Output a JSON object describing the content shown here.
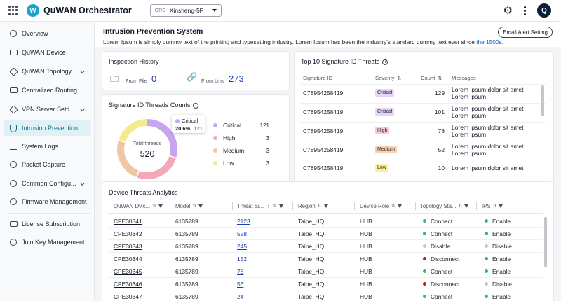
{
  "app": {
    "title": "QuWAN Orchestrator",
    "logo_letter": "W",
    "avatar_letter": "Q"
  },
  "org": {
    "label": "ORG",
    "value": "Xinsheng-5F"
  },
  "sidebar": {
    "items": [
      {
        "label": "Overview",
        "icon": "overview-icon"
      },
      {
        "label": "QuWAN Device",
        "icon": "device-icon"
      },
      {
        "label": "QuWAN Topology",
        "icon": "topology-icon"
      },
      {
        "label": "Centralized Routing",
        "icon": "routing-icon"
      },
      {
        "label": "VPN Server Setti...",
        "icon": "vpn-icon"
      },
      {
        "label": "Intrusion Prevention...",
        "icon": "shield-icon"
      },
      {
        "label": "System Logs",
        "icon": "logs-icon"
      },
      {
        "label": "Packet Capture",
        "icon": "capture-icon"
      },
      {
        "label": "Common Configu...",
        "icon": "config-icon"
      },
      {
        "label": "Firmware Management",
        "icon": "firmware-icon"
      },
      {
        "label": "License Subscription",
        "icon": "license-icon"
      },
      {
        "label": "Join Key Management",
        "icon": "key-icon"
      }
    ]
  },
  "page": {
    "title": "Intrusion Prevention System",
    "subtitle": "Lorem Ipsum is simply dummy text of the printing and typesetting industry. Lorem Ipsum has been the industry's standard dummy text ever since",
    "subtitle_link": "the 1500s.",
    "email_button": "Email Alert Setting"
  },
  "inspection": {
    "title": "Inspection History",
    "from_file_label": "From File",
    "from_file_value": "0",
    "from_link_label": "From Link",
    "from_link_value": "273"
  },
  "signature_counts": {
    "title": "Signature ID Threads Counts",
    "center_label": "Total threads",
    "total": "520",
    "tooltip": {
      "name": "Critical",
      "percent": "20.6%",
      "value": "121"
    },
    "legend": [
      {
        "name": "Critical",
        "value": "121",
        "color": "#c7a6f0"
      },
      {
        "name": "High",
        "value": "3",
        "color": "#f3a8b8"
      },
      {
        "name": "Medium",
        "value": "3",
        "color": "#f2c6a4"
      },
      {
        "name": "Low",
        "value": "3",
        "color": "#f7ea8e"
      }
    ]
  },
  "chart_data": {
    "type": "pie",
    "title": "Signature ID Threads Counts",
    "categories": [
      "Critical",
      "High",
      "Medium",
      "Low"
    ],
    "values": [
      121,
      3,
      3,
      3
    ],
    "display_fractions": [
      0.3,
      0.26,
      0.24,
      0.2
    ],
    "colors": [
      "#c7a6f0",
      "#f3a8b8",
      "#f2c6a4",
      "#f7ea8e"
    ]
  },
  "top10": {
    "title": "Top 10 Signature ID Threats",
    "headers": [
      "Signature ID",
      "Severity",
      "Count",
      "Messages"
    ],
    "rows": [
      {
        "id": "C78954258419",
        "severity": "Critical",
        "count": "129",
        "msg1": "Lorem ipsum dolor sit amet",
        "msg2": "Lorem ipsum"
      },
      {
        "id": "C78954258419",
        "severity": "Critical",
        "count": "101",
        "msg1": "Lorem ipsum dolor sit amet",
        "msg2": "Lorem ipsum"
      },
      {
        "id": "C78954258419",
        "severity": "High",
        "count": "78",
        "msg1": "Lorem ipsum dolor sit amet",
        "msg2": "Lorem ipsum"
      },
      {
        "id": "C78954258419",
        "severity": "Medium",
        "count": "52",
        "msg1": "Lorem ipsum dolor sit amet",
        "msg2": "Lorem ipsum"
      },
      {
        "id": "C78954258419",
        "severity": "Low",
        "count": "10",
        "msg1": "Lorem ipsum dolor sit amet",
        "msg2": ""
      }
    ],
    "severity_colors": {
      "Critical": "#e6d3f7",
      "High": "#f9c9d3",
      "Medium": "#f7d3b5",
      "Low": "#f7ef9a"
    }
  },
  "analytics": {
    "title": "Device Threats Analytics",
    "headers": [
      "QuWAN Dvic...",
      "Model",
      "Threat Si...",
      "Region",
      "Device Role",
      "Topology Sta...",
      "IPS"
    ],
    "rows": [
      {
        "device": "CPE30341",
        "model": "6135789",
        "threat": "2123",
        "region": "Taipe_HQ",
        "role": "HUB",
        "status": "Connect",
        "ips": "Enable"
      },
      {
        "device": "CPE30342",
        "model": "6135789",
        "threat": "528",
        "region": "Taipe_HQ",
        "role": "HUB",
        "status": "Connect",
        "ips": "Enable"
      },
      {
        "device": "CPE30343",
        "model": "6135789",
        "threat": "245",
        "region": "Taipe_HQ",
        "role": "HUB",
        "status": "Disable",
        "ips": "Disable"
      },
      {
        "device": "CPE30344",
        "model": "6135789",
        "threat": "152",
        "region": "Taipe_HQ",
        "role": "HUB",
        "status": "Disconnect",
        "ips": "Enable"
      },
      {
        "device": "CPE30345",
        "model": "6135789",
        "threat": "78",
        "region": "Taipe_HQ",
        "role": "HUB",
        "status": "Connect",
        "ips": "Enable"
      },
      {
        "device": "CPE30346",
        "model": "6135789",
        "threat": "56",
        "region": "Taipe_HQ",
        "role": "HUB",
        "status": "Disconnect",
        "ips": "Disable"
      },
      {
        "device": "CPE30347",
        "model": "6135789",
        "threat": "24",
        "region": "Taipe_HQ",
        "role": "HUB",
        "status": "Connect",
        "ips": "Enable"
      }
    ],
    "status_colors": {
      "Connect": "#22c55e",
      "Disable": "#c4c7cc",
      "Disconnect": "#b91c1c",
      "Enable": "#22c55e"
    }
  }
}
